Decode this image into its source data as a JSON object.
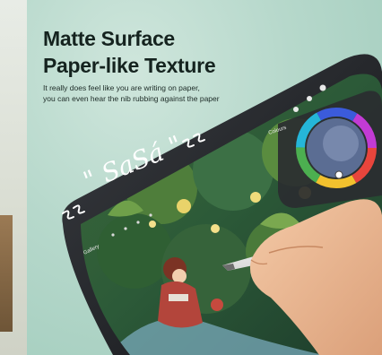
{
  "headline": {
    "line1": "Matte Surface",
    "line2": "Paper-like Texture"
  },
  "subline": {
    "line1": "It really does feel like you are writing on paper,",
    "line2": "you can even hear the nib rubbing against the paper"
  },
  "sound_effect": "\" SaSá \"",
  "app": {
    "gallery_label": "Gallery",
    "colours_label": "Colours"
  },
  "colors": {
    "background": "#b6d8cb",
    "text": "#15231f",
    "tablet_frame": "#1e2024"
  }
}
